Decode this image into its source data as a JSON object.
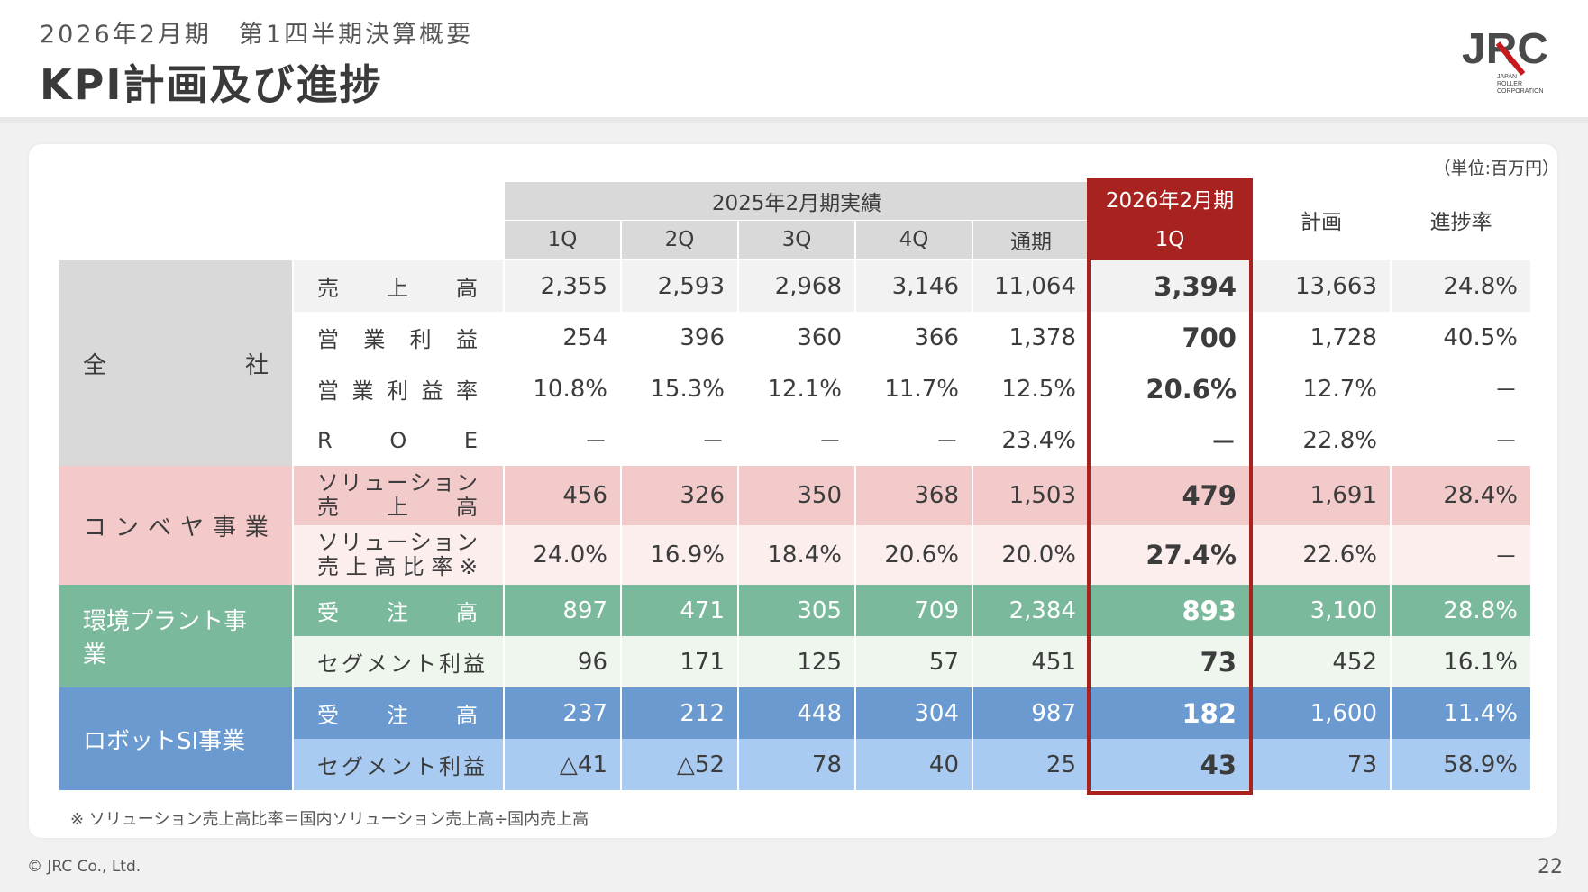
{
  "header": {
    "subtitle": "2026年2月期　第1四半期決算概要",
    "title": "KPI計画及び進捗",
    "logo_text": "JRC",
    "logo_sub": [
      "JAPAN",
      "ROLLER",
      "CORPORATION"
    ]
  },
  "unit_label": "（単位:百万円）",
  "table": {
    "group_header": "2025年2月期実績",
    "highlight_header": [
      "2026年2月期",
      "1Q"
    ],
    "plan_header": "計画",
    "progress_header": "進捗率",
    "quarter_headers": [
      "1Q",
      "2Q",
      "3Q",
      "4Q",
      "通期"
    ],
    "sections": [
      {
        "label_chars": [
          "全",
          "社"
        ],
        "rows": [
          {
            "label_chars": [
              "売",
              "上",
              "高"
            ],
            "values": [
              "2,355",
              "2,593",
              "2,968",
              "3,146",
              "11,064"
            ],
            "current": "3,394",
            "plan": "13,663",
            "progress": "24.8%"
          },
          {
            "label_chars": [
              "営",
              "業",
              "利",
              "益"
            ],
            "values": [
              "254",
              "396",
              "360",
              "366",
              "1,378"
            ],
            "current": "700",
            "plan": "1,728",
            "progress": "40.5%"
          },
          {
            "label_chars": [
              "営",
              "業",
              "利",
              "益",
              "率"
            ],
            "values": [
              "10.8%",
              "15.3%",
              "12.1%",
              "11.7%",
              "12.5%"
            ],
            "current": "20.6%",
            "plan": "12.7%",
            "progress": "－"
          },
          {
            "label_chars": [
              "R",
              "O",
              "E"
            ],
            "values": [
              "－",
              "－",
              "－",
              "－",
              "23.4%"
            ],
            "current": "－",
            "plan": "22.8%",
            "progress": "－"
          }
        ]
      },
      {
        "label_chars": [
          "コ",
          "ン",
          "ベ",
          "ヤ",
          "事",
          "業"
        ],
        "rows": [
          {
            "label_lines": [
              [
                "ソ",
                "リ",
                "ュ",
                "ー",
                "シ",
                "ョ",
                "ン"
              ],
              [
                "売",
                "上",
                "高"
              ]
            ],
            "values": [
              "456",
              "326",
              "350",
              "368",
              "1,503"
            ],
            "current": "479",
            "plan": "1,691",
            "progress": "28.4%"
          },
          {
            "label_lines": [
              [
                "ソ",
                "リ",
                "ュ",
                "ー",
                "シ",
                "ョ",
                "ン"
              ],
              [
                "売",
                "上",
                "高",
                "比",
                "率",
                "※"
              ]
            ],
            "values": [
              "24.0%",
              "16.9%",
              "18.4%",
              "20.6%",
              "20.0%"
            ],
            "current": "27.4%",
            "plan": "22.6%",
            "progress": "－"
          }
        ]
      },
      {
        "label": "環境プラント事業",
        "rows": [
          {
            "label_chars": [
              "受",
              "注",
              "高"
            ],
            "values": [
              "897",
              "471",
              "305",
              "709",
              "2,384"
            ],
            "current": "893",
            "plan": "3,100",
            "progress": "28.8%"
          },
          {
            "label": "セグメント利益",
            "values": [
              "96",
              "171",
              "125",
              "57",
              "451"
            ],
            "current": "73",
            "plan": "452",
            "progress": "16.1%"
          }
        ]
      },
      {
        "label": "ロボットSI事業",
        "rows": [
          {
            "label_chars": [
              "受",
              "注",
              "高"
            ],
            "values": [
              "237",
              "212",
              "448",
              "304",
              "987"
            ],
            "current": "182",
            "plan": "1,600",
            "progress": "11.4%"
          },
          {
            "label": "セグメント利益",
            "values": [
              "△41",
              "△52",
              "78",
              "40",
              "25"
            ],
            "current": "43",
            "plan": "73",
            "progress": "58.9%"
          }
        ]
      }
    ]
  },
  "footnote": "※ ソリューション売上高比率＝国内ソリューション売上高÷国内売上高",
  "copyright": "© JRC Co., Ltd.",
  "page_number": "22",
  "colors": {
    "highlight_red": "#a82220",
    "gray_section": "#d9d9d9",
    "pink_section": "#f3c9c9",
    "green_section": "#7ab99c",
    "blue_section": "#6b9ad1"
  }
}
